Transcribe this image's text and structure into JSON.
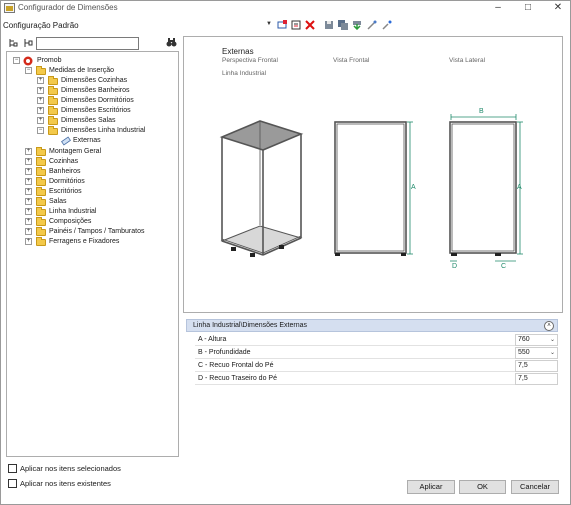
{
  "window": {
    "title": "Configurador de Dimensões"
  },
  "config": {
    "selected": "Configuração Padrão"
  },
  "tree": {
    "root": "Promob",
    "items": [
      {
        "label": "Medidas de Inserção"
      },
      {
        "label": "Dimensões Cozinhas"
      },
      {
        "label": "Dimensões Banheiros"
      },
      {
        "label": "Dimensões Dormitórios"
      },
      {
        "label": "Dimensões Escritórios"
      },
      {
        "label": "Dimensões Salas"
      },
      {
        "label": "Dimensões Linha Industrial"
      },
      {
        "label": "Externas"
      },
      {
        "label": "Montagem Geral"
      },
      {
        "label": "Cozinhas"
      },
      {
        "label": "Banheiros"
      },
      {
        "label": "Dormitórios"
      },
      {
        "label": "Escritórios"
      },
      {
        "label": "Salas"
      },
      {
        "label": "Linha Industrial"
      },
      {
        "label": "Composições"
      },
      {
        "label": "Painéis / Tampos / Tamburatos"
      },
      {
        "label": "Ferragens e Fixadores"
      }
    ]
  },
  "options": {
    "apply_selected": "Aplicar nos itens selecionados",
    "apply_existing": "Aplicar nos itens existentes"
  },
  "preview": {
    "title": "Externas",
    "subtitle": "Linha Industrial",
    "views": [
      "Perspectiva Frontal",
      "Vista Frontal",
      "Vista Lateral"
    ],
    "dim_labels": {
      "a": "A",
      "b": "B",
      "c": "C",
      "d": "D"
    },
    "accent_color": "#1f8a6a"
  },
  "properties": {
    "header": "Linha Industrial\\Dimensões Externas",
    "rows": [
      {
        "label": "A - Altura",
        "value": "760"
      },
      {
        "label": "B - Profundidade",
        "value": "550"
      },
      {
        "label": "C - Recuo Frontal do Pé",
        "value": "7,5"
      },
      {
        "label": "D - Recuo Traseiro do Pé",
        "value": "7,5"
      }
    ]
  },
  "buttons": {
    "apply": "Aplicar",
    "ok": "OK",
    "cancel": "Cancelar"
  }
}
